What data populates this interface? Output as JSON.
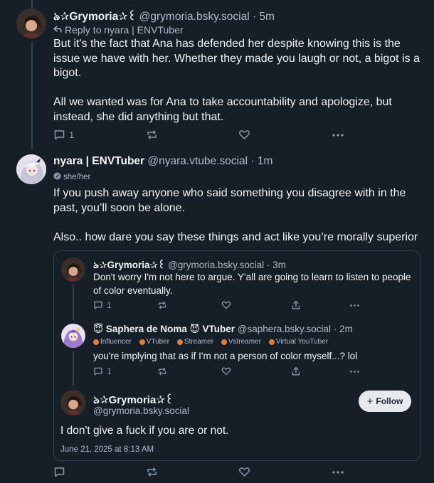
{
  "post1": {
    "display_name": "ঌ✰Grymoria✰꒰",
    "handle": "@grymoria.bsky.social",
    "time": "· 5m",
    "reply_to": "Reply to nyara | ENVTuber",
    "text": "But it's the fact that Ana has defended her despite knowing this is the issue we have with her. Whether they made you laugh or not, a bigot is a bigot.\n\nAll we wanted was for Ana to take accountability and apologize, but instead, she did anything but that.",
    "reply_count": "1"
  },
  "post2": {
    "display_name": "nyara | ENVTuber",
    "handle": "@nyara.vtube.social",
    "time": "· 1m",
    "pronouns": "she/her",
    "text": "If you push away anyone who said something you disagree with in the past, you’ll soon be alone.\n\nAlso.. how dare you say these things and act like you’re morally superior",
    "quote": {
      "post_a": {
        "display_name": "ঌ✰Grymoria✰꒰",
        "handle": "@grymoria.bsky.social",
        "time": "· 3m",
        "text": "Don't worry I'm not here to argue. Y'all are going to learn to listen to people of color eventually.",
        "reply_count": "1"
      },
      "post_b": {
        "display_name": "Saphera de Noma",
        "display_emoji_1": "😇",
        "display_emoji_2": "😈",
        "display_suffix": "VTuber",
        "handle": "@saphera.bsky.social",
        "time": "· 2m",
        "badges": [
          "Influencer",
          "VTuber",
          "Streamer",
          "Vstreamer",
          "Virtual YouTuber"
        ],
        "text": "you're implying that as if I'm not a person of color myself...? lol",
        "reply_count": "1"
      },
      "post_c": {
        "display_name": "ঌ✰Grymoria✰꒰",
        "handle": "@grymoria.bsky.social",
        "follow_label": "Follow",
        "text": "I don't give a fuck if you are or not.",
        "timestamp": "June 21, 2025 at 8:13 AM"
      }
    }
  },
  "icons": {
    "reply": "speech-bubble-icon",
    "repost": "repost-arrows-icon",
    "like": "heart-icon",
    "share": "share-icon",
    "more": "ellipsis-icon"
  },
  "colors": {
    "background": "#161e27",
    "text": "#f1f3f5",
    "muted": "#aebbc9",
    "border": "#2e4052"
  }
}
